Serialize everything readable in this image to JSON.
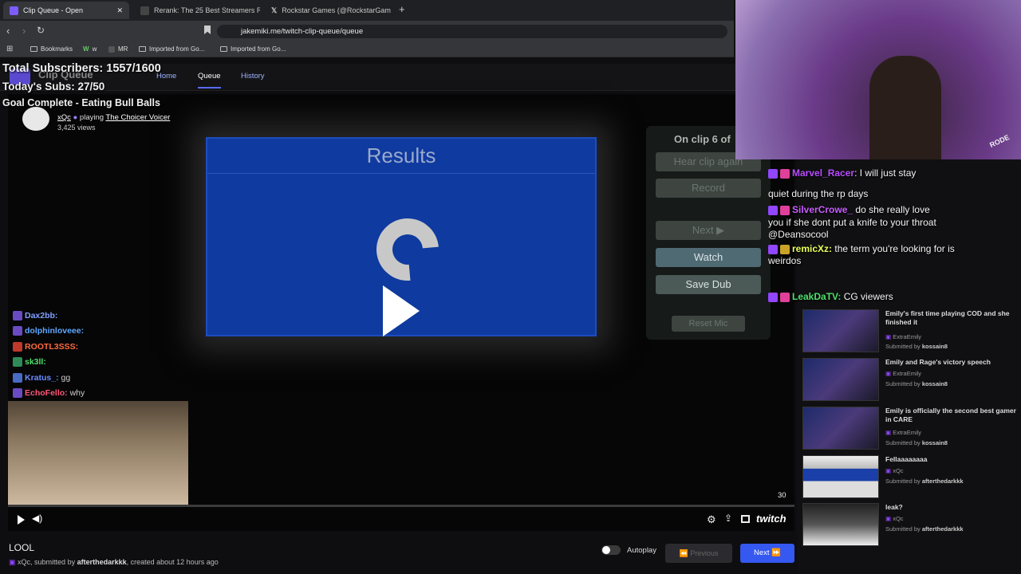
{
  "browser": {
    "tabs": [
      {
        "title": "Clip Queue - Open",
        "active": true
      },
      {
        "title": "Rerank: The 25 Best Streamers Right",
        "active": false
      },
      {
        "title": "Rockstar Games (@RockstarGames) /",
        "active": false
      }
    ],
    "url": "jakemiki.me/twitch-clip-queue/queue",
    "bookmarks": [
      "Bookmarks",
      "w",
      "MR",
      "Imported from Go...",
      "Imported from Go..."
    ]
  },
  "app": {
    "title": "Clip Queue",
    "nav": [
      "Home",
      "Queue",
      "History"
    ]
  },
  "overlay": {
    "total_subs": "Total Subscribers: 1557/1600",
    "today_subs": "Today's Subs: 27/50",
    "goal": "Goal Complete - Eating Bull Balls"
  },
  "clip_header": {
    "channel": "xQc",
    "playing_label": "playing",
    "game": "The Choicer Voicer",
    "views": "3,425 views"
  },
  "game_screen": {
    "title": "Results",
    "on_clip": "On clip 6 of",
    "buttons": [
      "Hear clip again",
      "Record",
      "Next ▶",
      "Watch",
      "Save Dub",
      "Reset Mic"
    ]
  },
  "left_chat": [
    {
      "user": "Dax2bb:",
      "msg": ""
    },
    {
      "user": "dolphinloveee:",
      "msg": ""
    },
    {
      "user": "ROOTL3SSS:",
      "msg": ""
    },
    {
      "user": "sk3ll:",
      "msg": ""
    },
    {
      "user": "Kratus_:",
      "msg": "gg"
    },
    {
      "user": "EchoFello:",
      "msg": "why"
    }
  ],
  "player": {
    "timestamp": "30",
    "brand": "twitch"
  },
  "clip_info": {
    "title": "LOOL",
    "channel": "xQc",
    "submitted_by_label": ", submitted by",
    "submitter": "afterthedarkkk",
    "created": ", created about 12 hours ago"
  },
  "controls": {
    "autoplay": "Autoplay",
    "previous": "Previous",
    "next": "Next"
  },
  "stream_chat": [
    {
      "user": "Marvel_Racer",
      "msg": ": I will just stay"
    },
    {
      "user": "",
      "msg": "quiet during the rp days"
    },
    {
      "user": "SilverCrowe_",
      "msg": "do she really love"
    },
    {
      "user": "",
      "msg": "you if she dont put a knife to your throat"
    },
    {
      "user": "",
      "msg": "@Deansocool"
    },
    {
      "user": "remicXz:",
      "msg": "the term you're looking for is"
    },
    {
      "user": "",
      "msg": "weirdos"
    },
    {
      "user": "LeakDaTV:",
      "msg": "CG viewers"
    }
  ],
  "queue": [
    {
      "title": "Emily's first time playing COD and she finished it",
      "channel": "ExtraEmily",
      "submitter": "kossain8"
    },
    {
      "title": "Emily and Rage's victory speech",
      "channel": "ExtraEmily",
      "submitter": "kossain8"
    },
    {
      "title": "Emily is officially the second best gamer in CARE",
      "channel": "ExtraEmily",
      "submitter": "kossain8"
    },
    {
      "title": "Fellaaaaaaaa",
      "channel": "xQc",
      "submitter": "afterthedarkkk"
    },
    {
      "title": "leak?",
      "channel": "xQc",
      "submitter": "afterthedarkkk"
    }
  ],
  "queue_labels": {
    "submitted_by": "Submitted by"
  },
  "webcam_label": "RODE",
  "colors": {
    "accent": "#3558f0",
    "results_bg": "#0f3a9f",
    "twitch_purple": "#9146ff"
  }
}
